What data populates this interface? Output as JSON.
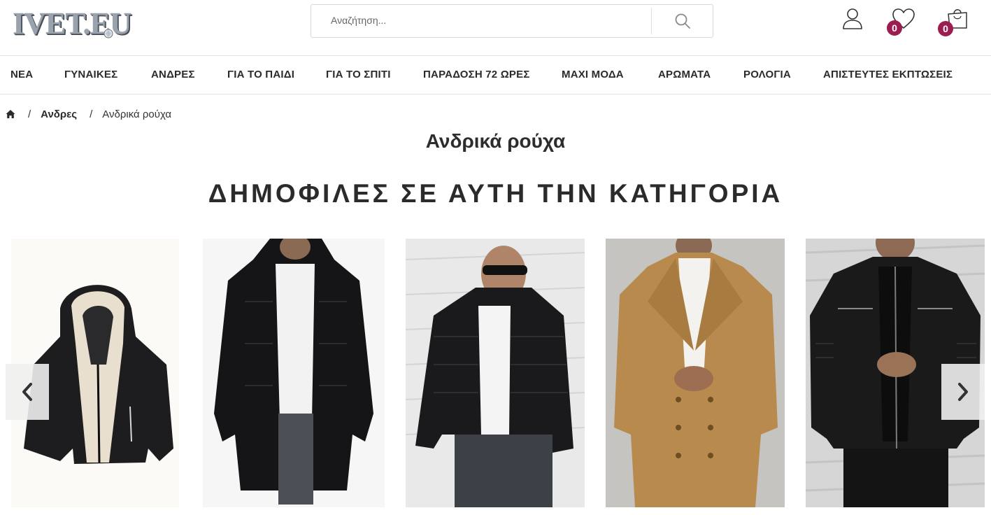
{
  "header": {
    "logo_text": "IVET.EU",
    "search": {
      "placeholder": "Αναζήτηση..."
    },
    "wishlist_count": "0",
    "cart_count": "0"
  },
  "nav": {
    "items": [
      "ΝΕΑ",
      "ΓΥΝΑΙΚΕΣ",
      "ΑΝΔΡΕΣ",
      "ΓΙΑ ΤΟ ΠΑΙΔΙ",
      "ΓΙΑ ΤΟ ΣΠΙΤΙ",
      "ΠΑΡΑΔΟΣΗ 72 ΩΡΕΣ",
      "ΜΑΧΙ ΜΟΔΑ",
      "ΑΡΩΜΑΤΑ",
      "ΡΟΛΟΓΙΑ",
      "ΑΠΙΣΤΕΥΤΕΣ ΕΚΠΤΩΣΕΙΣ"
    ]
  },
  "breadcrumb": {
    "separator": "/",
    "parent": "Ανδρες",
    "current": "Ανδρικά ρούχα"
  },
  "page_title": "Ανδρικά ρούχα",
  "section_title": "ΔΗΜΟΦΙΛΕΣ ΣΕ ΑΥΤΗ ΤΗΝ ΚΑΤΗΓΟΡΙΑ",
  "colors": {
    "badge": "#9c1d4f",
    "text": "#2b2b2b",
    "border": "#e3e3e3"
  },
  "icons": {
    "account": "user-icon",
    "wishlist": "heart-icon",
    "cart": "shopping-bag-icon",
    "search": "search-icon",
    "home": "home-icon",
    "prev": "chevron-left-icon",
    "next": "chevron-right-icon"
  }
}
